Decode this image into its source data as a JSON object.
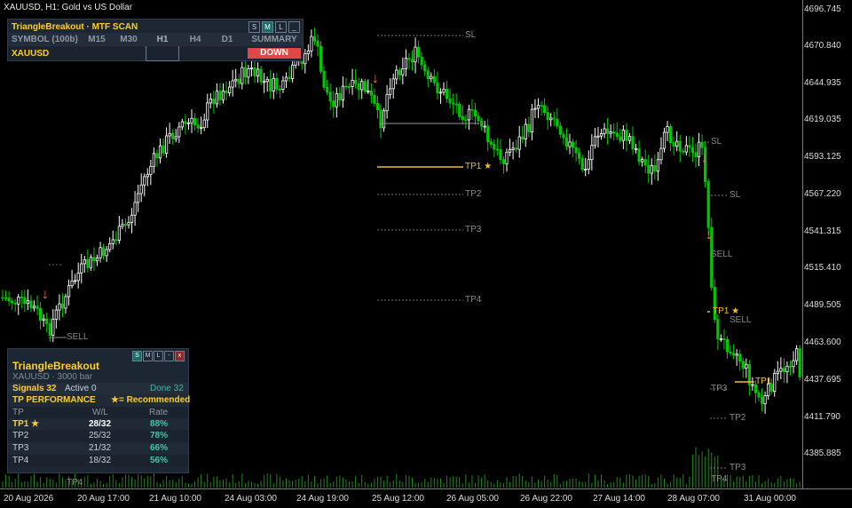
{
  "window": {
    "title": "XAUUSD, H1:  Gold vs US Dollar"
  },
  "price_axis": [
    "4696.745",
    "4670.840",
    "4644.935",
    "4619.035",
    "4593.125",
    "4567.220",
    "4541.315",
    "4515.410",
    "4489.505",
    "4463.600",
    "4437.695",
    "4411.790",
    "4385.885"
  ],
  "time_axis": [
    "20 Aug 2026",
    "20 Aug 17:00",
    "21 Aug 10:00",
    "24 Aug 03:00",
    "24 Aug 19:00",
    "25 Aug 12:00",
    "26 Aug 05:00",
    "26 Aug 22:00",
    "27 Aug 14:00",
    "28 Aug 07:00",
    "31 Aug 00:00"
  ],
  "mtf_panel": {
    "title": "TriangleBreakout · MTF SCAN",
    "buttons": [
      "S",
      "M",
      "L",
      "_"
    ],
    "columns": [
      "SYMBOL (100b)",
      "M15",
      "M30",
      "H1",
      "H4",
      "D1",
      "SUMMARY"
    ],
    "row": {
      "symbol": "XAUUSD",
      "summary": "DOWN"
    }
  },
  "perf_panel": {
    "buttons": [
      "S",
      "M",
      "L",
      "-",
      "x"
    ],
    "name": "TriangleBreakout",
    "subtitle": "XAUUSD · 3000 bar",
    "signals": "Signals 32",
    "active": "Active 0",
    "done": "Done 32",
    "section": "TP PERFORMANCE",
    "legend": "★= Recommended",
    "headers": [
      "TP",
      "W/L",
      "Rate"
    ],
    "rows": [
      {
        "tp": "TP1 ★",
        "wl": "28/32",
        "rate": "88%"
      },
      {
        "tp": "TP2",
        "wl": "25/32",
        "rate": "78%"
      },
      {
        "tp": "TP3",
        "wl": "21/32",
        "rate": "66%"
      },
      {
        "tp": "TP4",
        "wl": "18/32",
        "rate": "56%"
      }
    ]
  },
  "trade_labels": {
    "sl": "SL",
    "sell": "SELL",
    "tp1": "TP1",
    "tp1_star": "TP1 ★",
    "tp2": "TP2",
    "tp3": "TP3",
    "tp4": "TP4",
    "arrow": "↓"
  },
  "colors": {
    "bull": "#ffffff",
    "bear": "#00c800",
    "accent": "#ffcc33",
    "down": "#e04848",
    "rate": "#3cc8a8",
    "arrow": "#ff6a55"
  }
}
